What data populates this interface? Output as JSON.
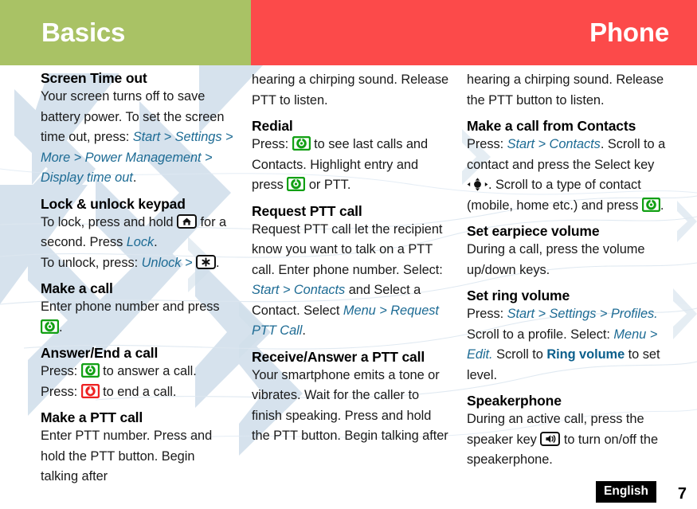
{
  "header": {
    "left_title": "Basics",
    "right_title": "Phone",
    "left_bg": "#a9c265",
    "right_bg": "#fc4a4a"
  },
  "colors": {
    "nav_link": "#1d6b94",
    "nav_bold": "#0b5f8c",
    "send_key": "#12a014",
    "end_key": "#ee2222",
    "watermark": "#c8d8e8",
    "body_text": "#1a1a1a"
  },
  "columns": [
    {
      "id": "column-1",
      "sections": [
        {
          "id": "screen-time-out",
          "heading": "Screen Time out",
          "runs": [
            {
              "t": "plain",
              "v": "Your screen turns off to save battery power. To set the screen time out, press: "
            },
            {
              "t": "nav",
              "v": "Start > Settings > More > Power Management > Display time out"
            },
            {
              "t": "plain",
              "v": "."
            }
          ]
        },
        {
          "id": "lock-unlock-keypad",
          "heading": "Lock & unlock keypad",
          "runs": [
            {
              "t": "plain",
              "v": "To lock, press and hold "
            },
            {
              "t": "icon",
              "v": "home-key-icon"
            },
            {
              "t": "plain",
              "v": " for a second. Press "
            },
            {
              "t": "nav",
              "v": "Lock"
            },
            {
              "t": "plain",
              "v": ".\nTo unlock, press: "
            },
            {
              "t": "nav",
              "v": "Unlock > "
            },
            {
              "t": "icon",
              "v": "asterisk-key-icon"
            },
            {
              "t": "plain",
              "v": "."
            }
          ]
        },
        {
          "id": "make-a-call",
          "heading": "Make a call",
          "runs": [
            {
              "t": "plain",
              "v": "Enter phone number and press "
            },
            {
              "t": "icon",
              "v": "send-key-icon"
            },
            {
              "t": "plain",
              "v": "."
            }
          ]
        },
        {
          "id": "answer-end-a-call",
          "heading": "Answer/End a call",
          "runs": [
            {
              "t": "plain",
              "v": "Press: "
            },
            {
              "t": "icon",
              "v": "send-key-icon"
            },
            {
              "t": "plain",
              "v": " to answer a call.\nPress: "
            },
            {
              "t": "icon",
              "v": "end-key-icon"
            },
            {
              "t": "plain",
              "v": " to end a call."
            }
          ]
        },
        {
          "id": "make-a-ptt-call",
          "heading": "Make a PTT call",
          "runs": [
            {
              "t": "plain",
              "v": "Enter PTT number. Press and hold the PTT button. Begin talking after"
            }
          ]
        }
      ]
    },
    {
      "id": "column-2",
      "sections": [
        {
          "id": "ptt-continuation",
          "heading": null,
          "runs": [
            {
              "t": "plain",
              "v": "hearing a chirping sound. Release PTT to listen."
            }
          ]
        },
        {
          "id": "redial",
          "heading": "Redial",
          "runs": [
            {
              "t": "plain",
              "v": "Press: "
            },
            {
              "t": "icon",
              "v": "send-key-icon"
            },
            {
              "t": "plain",
              "v": " to see last calls and Contacts. Highlight entry and press "
            },
            {
              "t": "icon",
              "v": "send-key-icon"
            },
            {
              "t": "plain",
              "v": " or PTT."
            }
          ]
        },
        {
          "id": "request-ptt-call",
          "heading": "Request PTT call",
          "runs": [
            {
              "t": "plain",
              "v": "Request PTT call let the recipient know you want to talk on a PTT call. Enter phone number. Select: "
            },
            {
              "t": "nav",
              "v": "Start > Contacts"
            },
            {
              "t": "plain",
              "v": " and Select a Contact. Select "
            },
            {
              "t": "nav",
              "v": "Menu > Request PTT Call"
            },
            {
              "t": "plain",
              "v": "."
            }
          ]
        },
        {
          "id": "receive-answer-ptt-call",
          "heading": "Receive/Answer a PTT call",
          "runs": [
            {
              "t": "plain",
              "v": "Your smartphone emits a tone or vibrates. Wait for the caller to finish speaking. Press and hold the PTT button. Begin talking after"
            }
          ]
        }
      ]
    },
    {
      "id": "column-3",
      "sections": [
        {
          "id": "ptt-continuation-2",
          "heading": null,
          "runs": [
            {
              "t": "plain",
              "v": "hearing a chirping sound. Release the PTT button to listen."
            }
          ]
        },
        {
          "id": "make-call-from-contacts",
          "heading": "Make a call from Contacts",
          "runs": [
            {
              "t": "plain",
              "v": "Press: "
            },
            {
              "t": "nav",
              "v": "Start > Contacts"
            },
            {
              "t": "plain",
              "v": ". Scroll to a contact and press the Select key "
            },
            {
              "t": "icon",
              "v": "select-key-icon"
            },
            {
              "t": "plain",
              "v": ". Scroll to a type of contact (mobile, home etc.) and press "
            },
            {
              "t": "icon",
              "v": "send-key-icon"
            },
            {
              "t": "plain",
              "v": "."
            }
          ]
        },
        {
          "id": "set-earpiece-volume",
          "heading": "Set earpiece volume",
          "runs": [
            {
              "t": "plain",
              "v": "During a call, press the volume up/down keys."
            }
          ]
        },
        {
          "id": "set-ring-volume",
          "heading": "Set ring volume",
          "runs": [
            {
              "t": "plain",
              "v": "Press: "
            },
            {
              "t": "nav",
              "v": "Start > Settings > Profiles."
            },
            {
              "t": "plain",
              "v": " Scroll to a profile. Select: "
            },
            {
              "t": "nav",
              "v": "Menu > Edit."
            },
            {
              "t": "plain",
              "v": " Scroll to "
            },
            {
              "t": "navb",
              "v": "Ring volume"
            },
            {
              "t": "plain",
              "v": " to set level."
            }
          ]
        },
        {
          "id": "speakerphone",
          "heading": "Speakerphone",
          "runs": [
            {
              "t": "plain",
              "v": "During an active call, press the speaker key "
            },
            {
              "t": "icon",
              "v": "speaker-key-icon"
            },
            {
              "t": "plain",
              "v": " to turn on/off the speakerphone."
            }
          ]
        }
      ]
    }
  ],
  "footer": {
    "language": "English",
    "page_number": "7"
  }
}
